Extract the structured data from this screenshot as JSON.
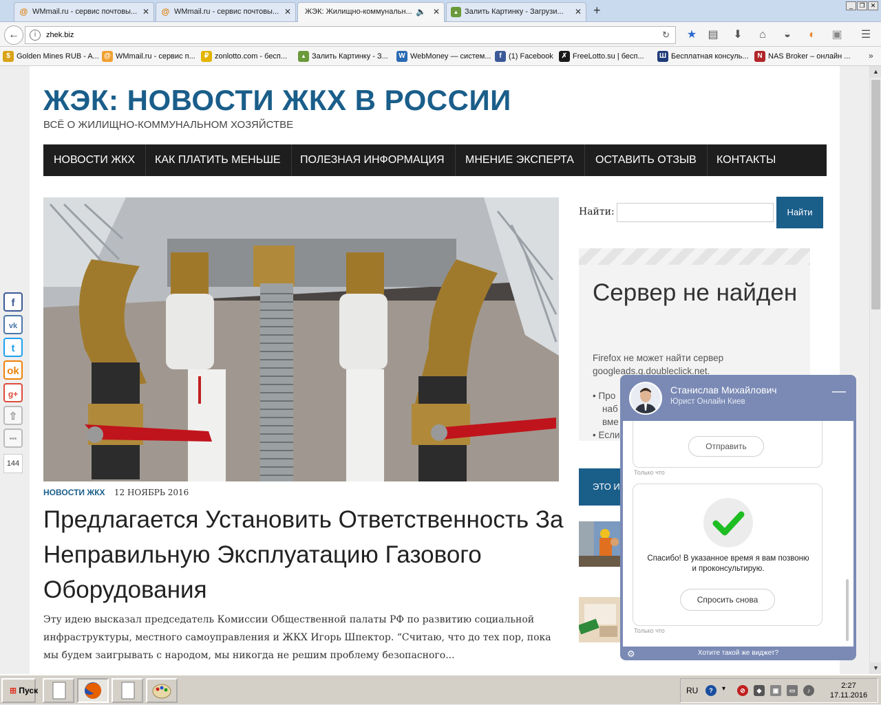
{
  "browser": {
    "tabs": [
      {
        "title": "WMmail.ru - сервис почтовы...",
        "active": false
      },
      {
        "title": "WMmail.ru - сервис почтовы...",
        "active": false
      },
      {
        "title": "ЖЭК: Жилищно-коммунальн...",
        "active": true
      },
      {
        "title": "Залить Картинку - Загрузи...",
        "active": false
      }
    ],
    "new_tab": "+",
    "url": "zhek.biz",
    "bookmarks": [
      "Golden Mines RUB - A...",
      "WMmail.ru - сервис п...",
      "zonlotto.com - бесп...",
      "Залить Картинку - З...",
      "WebMoney — систем...",
      "(1) Facebook",
      "FreeLotto.su | бесп...",
      "Бесплатная консуль...",
      "NAS Broker – онлайн ..."
    ]
  },
  "site": {
    "title": "ЖЭК: НОВОСТИ ЖКХ В РОССИИ",
    "subtitle": "ВСЁ О ЖИЛИЩНО-КОММУНАЛЬНОМ ХОЗЯЙСТВЕ",
    "nav": [
      "НОВОСТИ ЖКХ",
      "КАК ПЛАТИТЬ МЕНЬШЕ",
      "ПОЛЕЗНАЯ ИНФОРМАЦИЯ",
      "МНЕНИЕ ЭКСПЕРТА",
      "ОСТАВИТЬ ОТЗЫВ",
      "КОНТАКТЫ"
    ]
  },
  "article": {
    "category": "НОВОСТИ ЖКХ",
    "date": "12 НОЯБРЬ 2016",
    "headline": "Предлагается Установить Ответственность За Неправильную Эксплуатацию Газового Оборудования",
    "excerpt": "Эту идею высказал председатель Комиссии Общественной палаты РФ по развитию социальной инфраструктуры, местного самоуправления и ЖКХ Игорь Шпектор. “Считаю, что до тех пор, пока мы будем заигрывать с народом, мы никогда не решим проблему безопасного..."
  },
  "sidebar": {
    "search_label": "Найти:",
    "search_value": "",
    "search_button": "Найти",
    "error_title": "Сервер не найден",
    "error_text": "Firefox не может найти сервер googleads.g.doubleclick.net.",
    "error_items": [
      "Про",
      "наб",
      "вме",
      "Если"
    ],
    "band_text": "ЭТО И"
  },
  "social": {
    "buttons": [
      "f",
      "vk",
      "t",
      "ok",
      "g+",
      "⇧",
      "•••"
    ],
    "share_count": "144"
  },
  "chat": {
    "agent_name": "Станислав Михайлович",
    "agent_role": "Юрист Онлайн Киев",
    "minimize": "—",
    "send_button": "Отправить",
    "timestamp1": "Только что",
    "thanks_text": "Спасибо! В указанное время я вам позвоню и проконсультирую.",
    "ask_again_button": "Спросить снова",
    "timestamp2": "Только что",
    "footer": "Хотите такой же виджет?"
  },
  "taskbar": {
    "start": "Пуск",
    "lang": "RU",
    "time": "2:27",
    "date": "17.11.2016"
  }
}
